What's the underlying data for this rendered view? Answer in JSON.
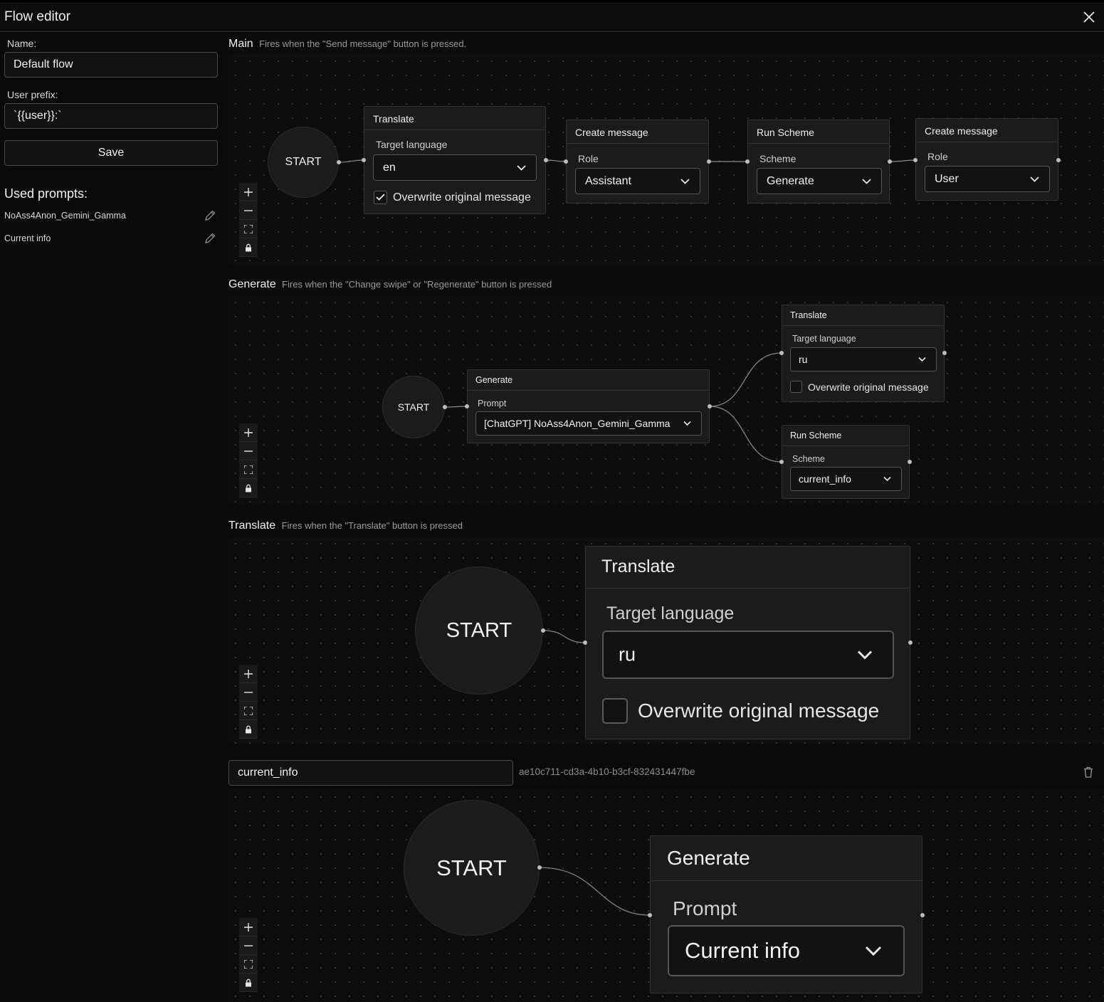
{
  "app": {
    "title": "Flow editor"
  },
  "sidebar": {
    "name_label": "Name:",
    "name_value": "Default flow",
    "prefix_label": "User prefix:",
    "prefix_value": "`{{user}}:`",
    "save_label": "Save",
    "used_prompts_title": "Used prompts:",
    "used_prompts": [
      {
        "name": "NoAss4Anon_Gemini_Gamma"
      },
      {
        "name": "Current info"
      }
    ]
  },
  "sections": {
    "main": {
      "name": "Main",
      "description": "Fires when the \"Send message\" button is pressed.",
      "start_label": "START",
      "translate": {
        "title": "Translate",
        "label": "Target language",
        "value": "en",
        "checkbox_label": "Overwrite original message",
        "checked": true
      },
      "create1": {
        "title": "Create message",
        "label": "Role",
        "value": "Assistant"
      },
      "run_scheme": {
        "title": "Run Scheme",
        "label": "Scheme",
        "value": "Generate"
      },
      "create2": {
        "title": "Create message",
        "label": "Role",
        "value": "User"
      }
    },
    "generate": {
      "name": "Generate",
      "description": "Fires when the \"Change swipe\" or \"Regenerate\" button is pressed",
      "start_label": "START",
      "generate": {
        "title": "Generate",
        "label": "Prompt",
        "value": "[ChatGPT] NoAss4Anon_Gemini_Gamma"
      },
      "translate": {
        "title": "Translate",
        "label": "Target language",
        "value": "ru",
        "checkbox_label": "Overwrite original message",
        "checked": false
      },
      "run_scheme": {
        "title": "Run Scheme",
        "label": "Scheme",
        "value": "current_info"
      }
    },
    "translate": {
      "name": "Translate",
      "description": "Fires when the \"Translate\" button is pressed",
      "start_label": "START",
      "translate": {
        "title": "Translate",
        "label": "Target language",
        "value": "ru",
        "checkbox_label": "Overwrite original message",
        "checked": false
      }
    },
    "scheme": {
      "name_value": "current_info",
      "id": "ae10c711-cd3a-4b10-b3cf-832431447fbe",
      "start_label": "START",
      "generate": {
        "title": "Generate",
        "label": "Prompt",
        "value": "Current info"
      }
    }
  },
  "icons": {
    "close": "close-icon",
    "edit": "pencil-icon",
    "zoom_in": "plus-icon",
    "zoom_out": "minus-icon",
    "fit": "fit-view-icon",
    "lock": "lock-icon",
    "dropdown": "chevron-down-icon",
    "delete": "trash-icon",
    "check": "check-icon"
  },
  "colors": {
    "background": "#0a0a0a",
    "node": "#1b1b1b",
    "border": "#323232",
    "text": "#f0f0f0",
    "muted": "#9a9a9a"
  }
}
